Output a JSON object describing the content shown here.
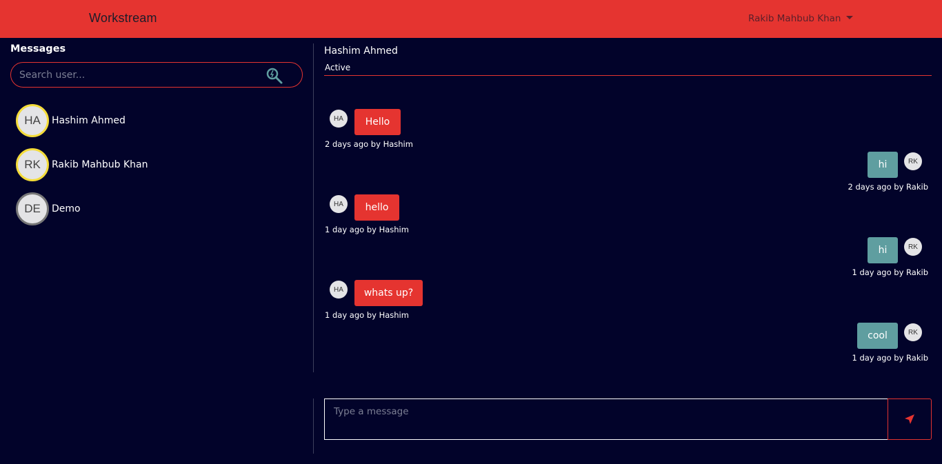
{
  "app": {
    "brand": "Workstream",
    "current_user": "Rakib Mahbub Khan"
  },
  "sidebar": {
    "title": "Messages",
    "search": {
      "placeholder": "Search user...",
      "value": ""
    },
    "users": [
      {
        "initials": "HA",
        "name": "Hashim Ahmed",
        "status": "online"
      },
      {
        "initials": "RK",
        "name": "Rakib Mahbub Khan",
        "status": "online"
      },
      {
        "initials": "DE",
        "name": "Demo",
        "status": "offline"
      }
    ]
  },
  "chat": {
    "name": "Hashim Ahmed",
    "status": "Active",
    "messages": [
      {
        "from": "in",
        "initials": "HA",
        "text": "Hello",
        "meta": "2 days ago by Hashim"
      },
      {
        "from": "out",
        "initials": "RK",
        "text": "hi",
        "meta": "2 days ago by Rakib"
      },
      {
        "from": "in",
        "initials": "HA",
        "text": "hello",
        "meta": "1 day ago by Hashim"
      },
      {
        "from": "out",
        "initials": "RK",
        "text": "hi",
        "meta": "1 day ago by Rakib"
      },
      {
        "from": "in",
        "initials": "HA",
        "text": "whats up?",
        "meta": "1 day ago by Hashim"
      },
      {
        "from": "out",
        "initials": "RK",
        "text": "cool",
        "meta": "1 day ago by Rakib"
      }
    ],
    "composer": {
      "placeholder": "Type a message",
      "value": ""
    }
  },
  "colors": {
    "background": "#02032a",
    "accent": "#e53430",
    "outgoing": "#5f9ea0",
    "online_ring": "#f4dc3a",
    "offline_ring": "#777777"
  },
  "icons": {
    "search": "search-icon",
    "send": "send-icon"
  }
}
